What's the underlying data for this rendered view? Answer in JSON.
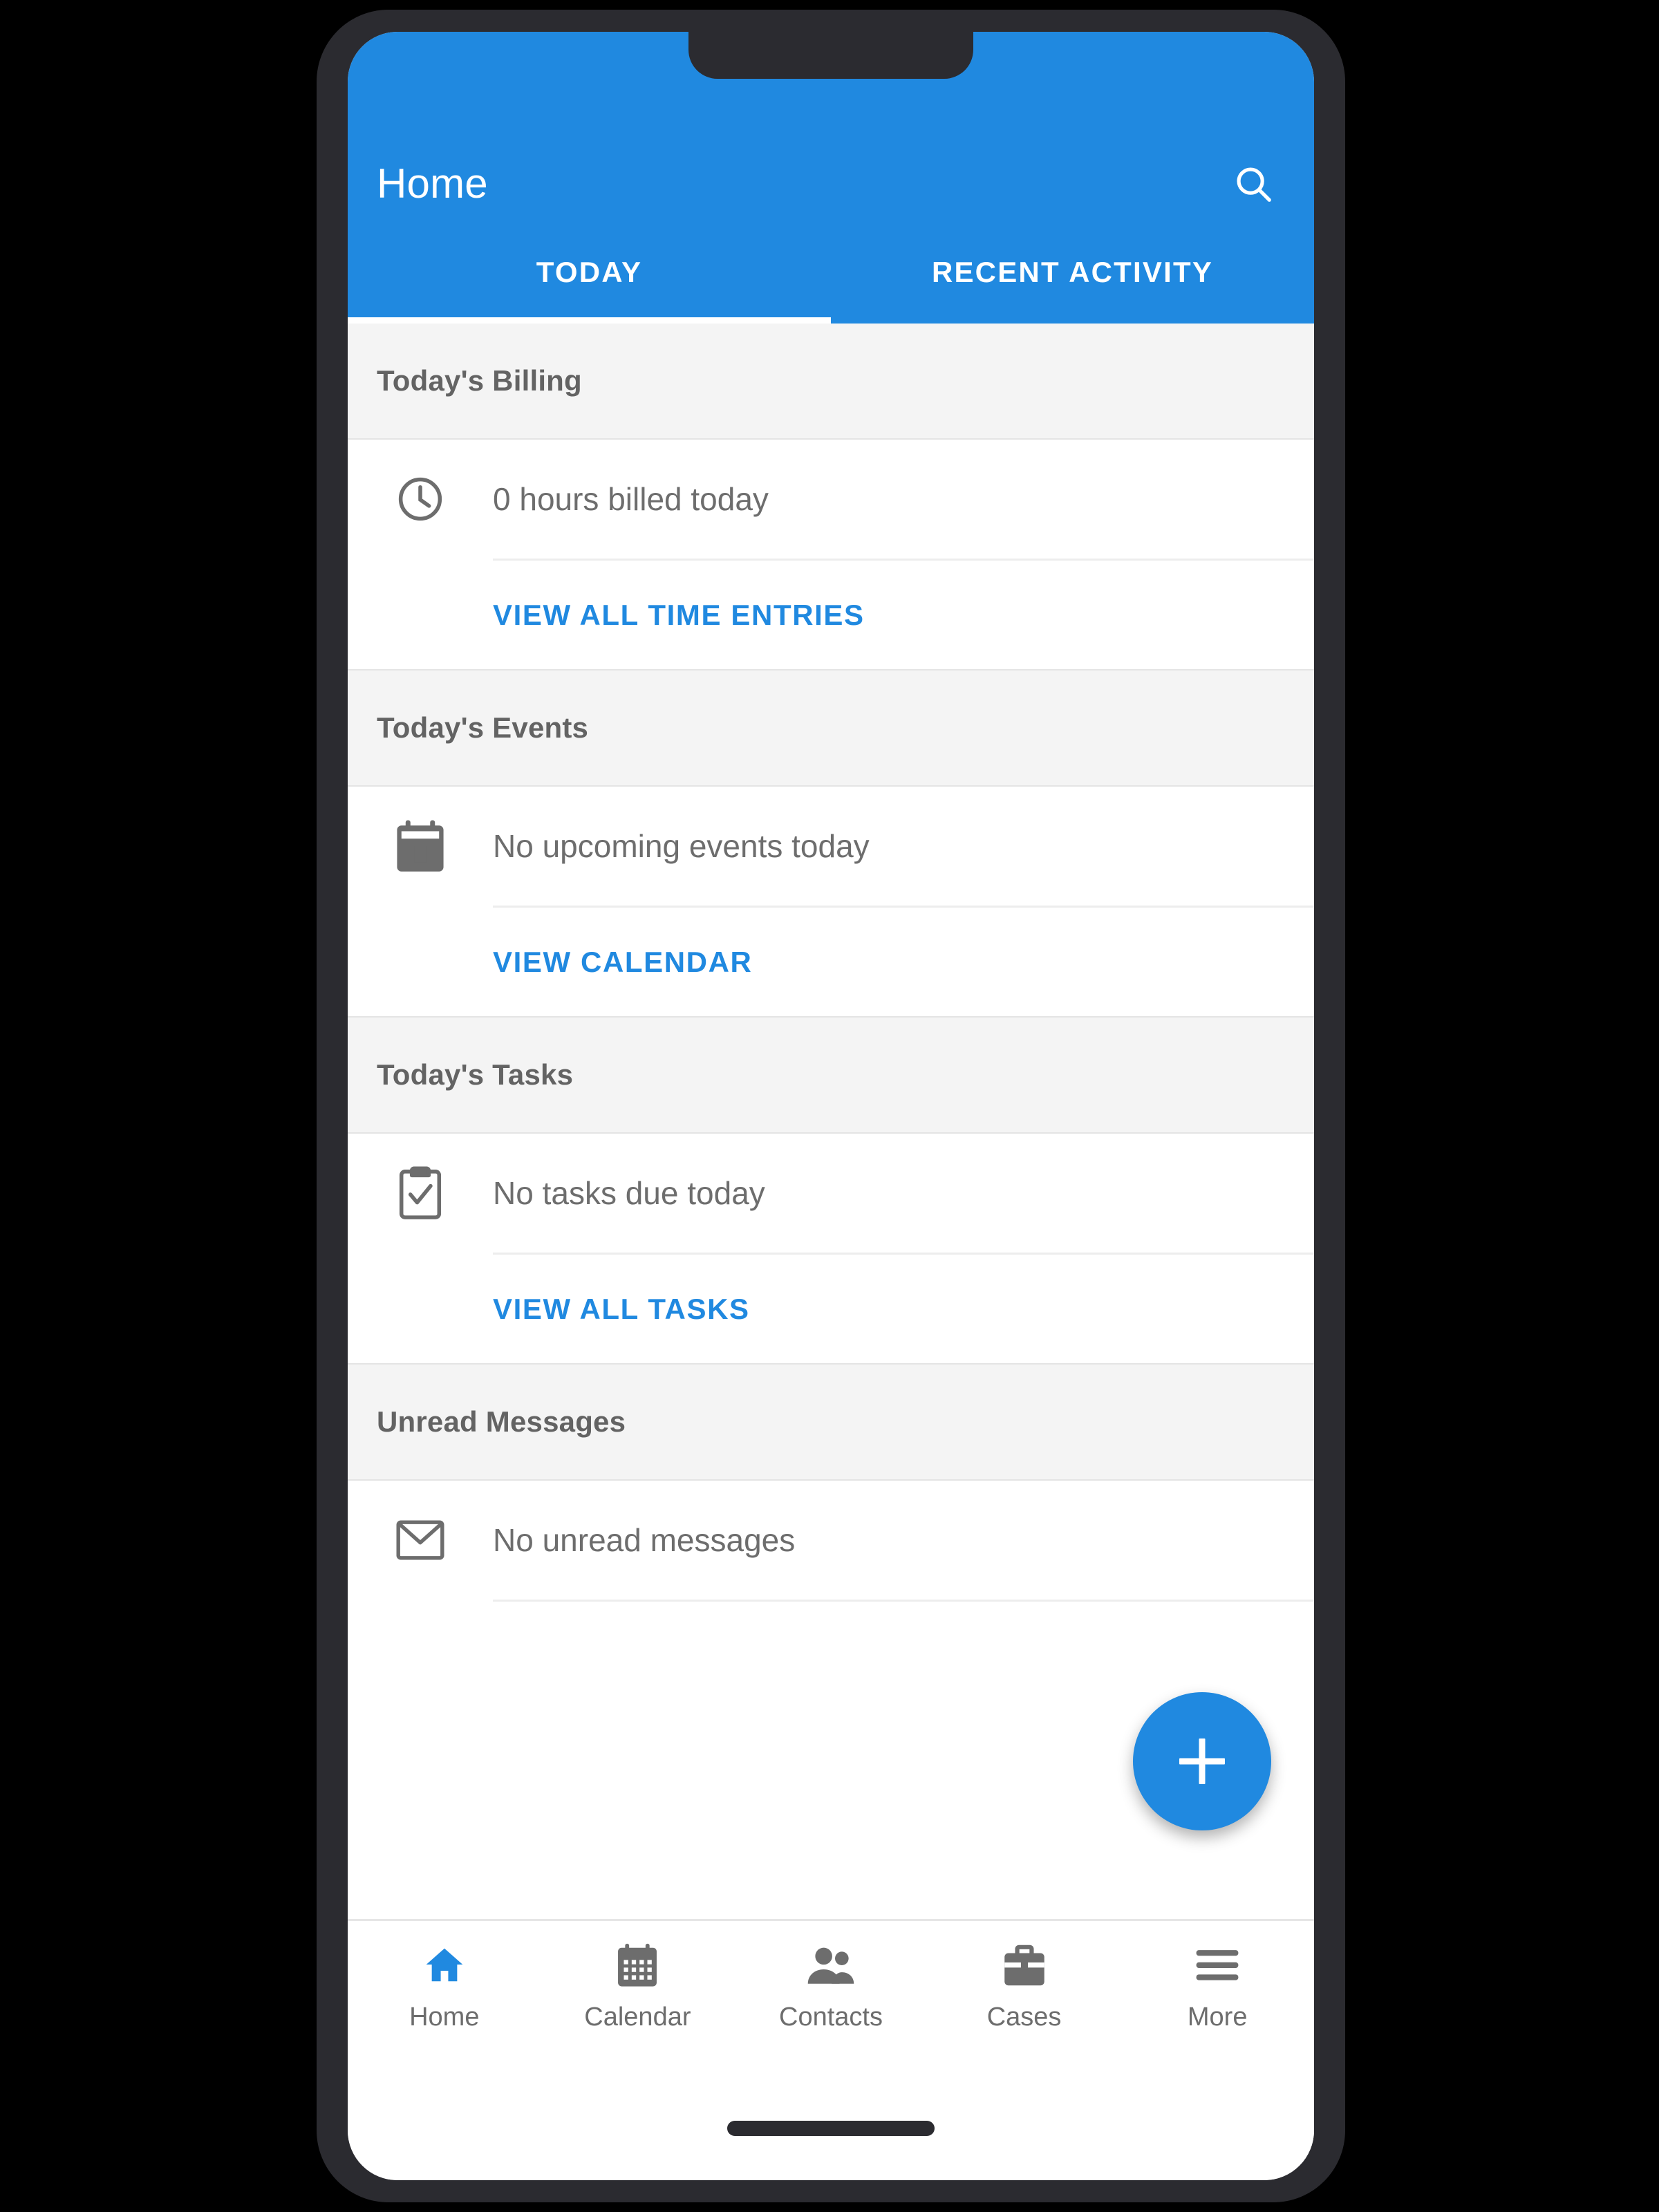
{
  "theme": {
    "accent": "#2089e0",
    "frame": "#2b2b30",
    "section_bg": "#f4f4f4",
    "body_text": "#6d6d6d",
    "header_text": "#636363",
    "page_bg": "#000000"
  },
  "appbar": {
    "title": "Home",
    "search_icon": "search-icon"
  },
  "tabs": [
    {
      "label": "TODAY",
      "active": true
    },
    {
      "label": "RECENT ACTIVITY",
      "active": false
    }
  ],
  "sections": [
    {
      "header": "Today's Billing",
      "icon": "clock-icon",
      "empty_text": "0 hours billed today",
      "action_label": "VIEW ALL TIME ENTRIES"
    },
    {
      "header": "Today's Events",
      "icon": "calendar-icon",
      "empty_text": "No upcoming events today",
      "action_label": "VIEW CALENDAR"
    },
    {
      "header": "Today's Tasks",
      "icon": "clipboard-check-icon",
      "empty_text": "No tasks due today",
      "action_label": "VIEW ALL TASKS"
    },
    {
      "header": "Unread Messages",
      "icon": "envelope-icon",
      "empty_text": "No unread messages",
      "action_label": ""
    }
  ],
  "fab": {
    "icon": "plus-icon",
    "label": "+"
  },
  "bottom_nav": [
    {
      "label": "Home",
      "icon": "home-icon",
      "active": true
    },
    {
      "label": "Calendar",
      "icon": "calendar-icon",
      "active": false
    },
    {
      "label": "Contacts",
      "icon": "contacts-icon",
      "active": false
    },
    {
      "label": "Cases",
      "icon": "briefcase-icon",
      "active": false
    },
    {
      "label": "More",
      "icon": "menu-icon",
      "active": false
    }
  ]
}
